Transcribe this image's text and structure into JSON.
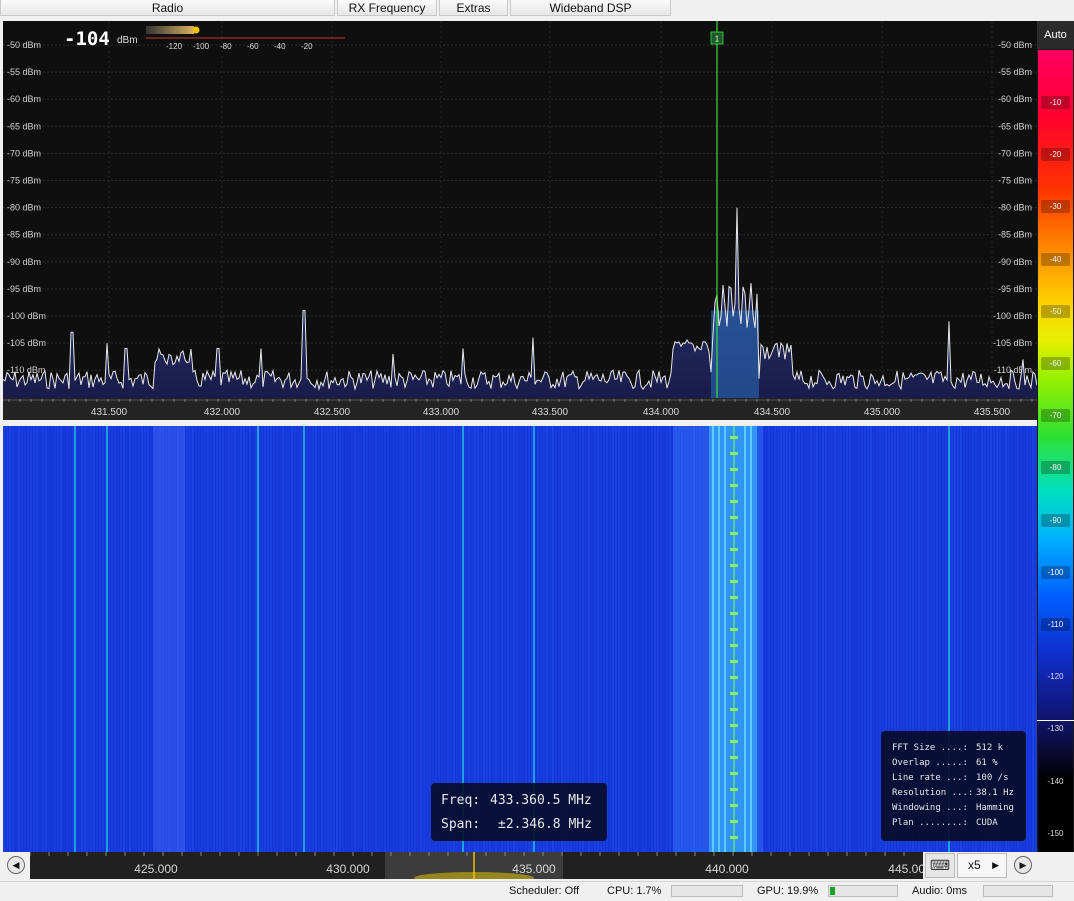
{
  "tabs": [
    "Radio",
    "RX Frequency",
    "Extras",
    "Wideband DSP"
  ],
  "spectrum": {
    "level_value": "-104",
    "level_unit": "dBm",
    "meter_scale": [
      "-120",
      "-100",
      "-80",
      "-60",
      "-40",
      "-20"
    ],
    "db_labels": [
      "-50 dBm",
      "-55 dBm",
      "-60 dBm",
      "-65 dBm",
      "-70 dBm",
      "-75 dBm",
      "-80 dBm",
      "-85 dBm",
      "-90 dBm",
      "-95 dBm",
      "-100 dBm",
      "-105 dBm",
      "-110 dBm"
    ],
    "freq_labels": [
      "431.500",
      "432.000",
      "432.500",
      "433.000",
      "433.500",
      "434.000",
      "434.500",
      "435.000",
      "435.500"
    ],
    "marker_label": "1"
  },
  "waterfall": {
    "freq_labels": [
      "425.000",
      "430.000",
      "435.000",
      "440.000",
      "445.000"
    ],
    "info": {
      "freq_label": "Freq:",
      "freq_value": "433.360.5 MHz",
      "span_label": "Span:",
      "span_value": "±2.346.8 MHz"
    },
    "fft_info": [
      {
        "key": "FFT Size ....:",
        "value": "512 k"
      },
      {
        "key": "Overlap .....:",
        "value": "61 %"
      },
      {
        "key": "Line rate ...:",
        "value": "100 /s"
      },
      {
        "key": "Resolution ...:",
        "value": "38.1 Hz"
      },
      {
        "key": "Windowing ...:",
        "value": "Hamming"
      },
      {
        "key": "Plan ........:",
        "value": "CUDA"
      }
    ]
  },
  "colorbar": {
    "auto_label": "Auto",
    "labels": [
      "-10",
      "-20",
      "-30",
      "-40",
      "-50",
      "-60",
      "-70",
      "-80",
      "-90",
      "-100",
      "-110",
      "-120",
      "-130",
      "-140",
      "-150"
    ]
  },
  "tools": {
    "zoom_value": "x5",
    "keyboard_icon": "keyboard-icon",
    "prev_icon": "skip-back-icon",
    "next_icon": "skip-forward-icon"
  },
  "status": {
    "scheduler": "Scheduler: Off",
    "cpu": "CPU: 1.7%",
    "gpu": "GPU: 19.9%",
    "audio": "Audio: 0ms",
    "gpu_load": 0.07
  },
  "colors": {
    "accent_green": "#3cdc3c",
    "waterfall_blue": "#1436d8",
    "trace": "#e8e8e8"
  }
}
